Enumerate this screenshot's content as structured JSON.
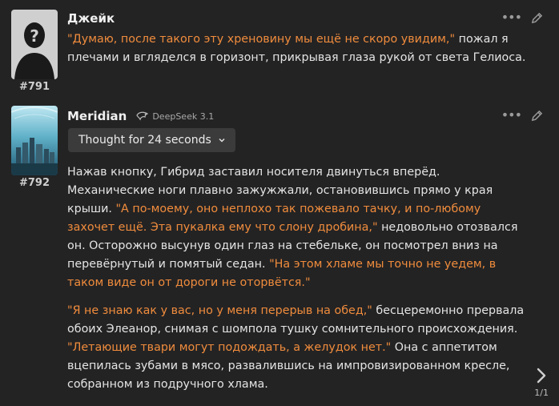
{
  "messages": [
    {
      "name": "Джейк",
      "mesid": "#791",
      "avatar_icon": "silhouette-avatar",
      "paragraphs": [
        [
          {
            "quote": true,
            "text": "\"Думаю, после такого эту хреновину мы ещё не скоро увидим,\""
          },
          {
            "quote": false,
            "text": " пожал я плечами и вгляделся в горизонт, прикрывая глаза рукой от света Гелиоса."
          }
        ]
      ]
    },
    {
      "name": "Meridian",
      "mesid": "#792",
      "avatar_icon": "underwater-city-avatar",
      "model_icon": "model-icon",
      "model": "DeepSeek 3.1",
      "thought_label": "Thought for 24 seconds",
      "paragraphs": [
        [
          {
            "quote": false,
            "text": "Нажав кнопку, Гибрид заставил носителя двинуться вперёд. Механические ноги плавно зажужжали, остановившись прямо у края крыши. "
          },
          {
            "quote": true,
            "text": "\"А по-моему, оно неплохо так пожевало тачку, и по-любому захочет ещё. Эта пукалка ему что слону дробина,\""
          },
          {
            "quote": false,
            "text": " недовольно отозвался он. Осторожно высунув один глаз на стебельке, он посмотрел вниз на перевёрнутый и помятый седан. "
          },
          {
            "quote": true,
            "text": "\"На этом хламе мы точно не уедем, в таком виде он от дороги не оторвётся.\""
          }
        ],
        [
          {
            "quote": true,
            "text": "\"Я не знаю как у вас, но у меня перерыв на обед,\""
          },
          {
            "quote": false,
            "text": " бесцеремонно прервала обоих Элеанор, снимая с шомпола тушку сомнительного происхождения. "
          },
          {
            "quote": true,
            "text": "\"Летающие твари могут подождать, а желудок нет.\""
          },
          {
            "quote": false,
            "text": " Она с аппетитом вцепилась зубами в мясо, развалившись на импровизированном кресле, собранном из подручного хлама."
          }
        ]
      ],
      "swipe_counter": "1/1"
    }
  ],
  "icons": {
    "more": "more-dots-icon",
    "edit": "edit-pencil-icon",
    "chevron": "chevron-down-icon",
    "swipe": "swipe-right-icon"
  },
  "colors": {
    "quote": "#f08c3c",
    "background": "#232324",
    "button": "#3b3b3c"
  }
}
